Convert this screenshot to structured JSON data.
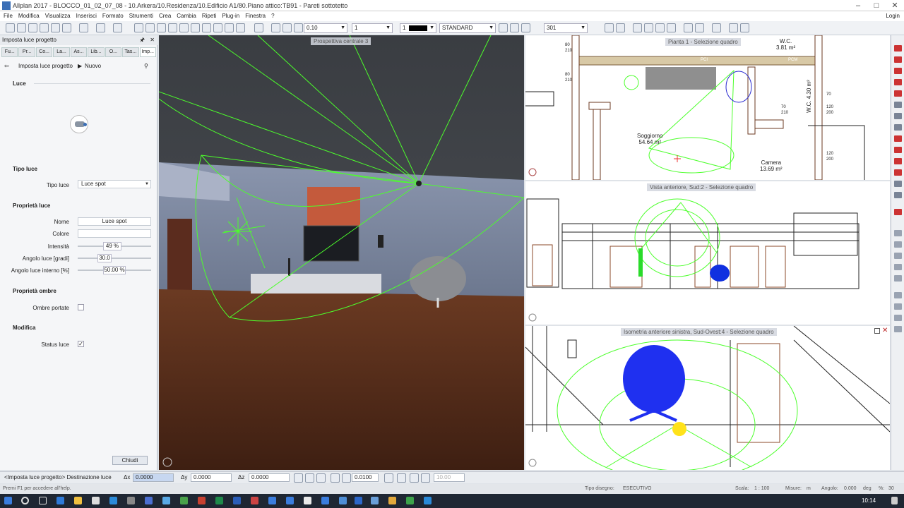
{
  "window": {
    "title": "Allplan 2017 - BLOCCO_01_02_07_08 - 10.Arkera/10.Residenza/10.Edificio A1/80.Piano attico:TB91 - Pareti sottotetto",
    "minimize": "–",
    "maximize": "□",
    "close": "✕"
  },
  "menu": {
    "items": [
      "File",
      "Modifica",
      "Visualizza",
      "Inserisci",
      "Formato",
      "Strumenti",
      "Crea",
      "Cambia",
      "Ripeti",
      "Plug-in",
      "Finestra",
      "?"
    ],
    "login": "Login"
  },
  "toolbar": {
    "pen": "0.10",
    "line": "1",
    "color": "1",
    "layer": "STANDARD",
    "scale": "301"
  },
  "panel": {
    "header": "Imposta luce progetto",
    "pin": "✕",
    "tabs": [
      "Fu...",
      "Pr...",
      "Co...",
      "La...",
      "As...",
      "Lib...",
      "O...",
      "Tas...",
      "Imp..."
    ],
    "back": "⇦",
    "breadcrumb": [
      "Imposta luce progetto",
      "Nuovo"
    ],
    "sections": {
      "luce": "Luce",
      "tipo": "Tipo luce",
      "proprieta": "Proprietà luce",
      "ombre": "Proprietà ombre",
      "modifica": "Modifica"
    },
    "fields": {
      "tipo_label": "Tipo luce",
      "tipo_value": "Luce spot",
      "nome_label": "Nome",
      "nome_value": "Luce spot",
      "colore_label": "Colore",
      "intensita_label": "Intensità",
      "intensita_value": "49 %",
      "angolo_label": "Angolo luce [gradi]",
      "angolo_value": "30.0",
      "interno_label": "Angolo luce interno [%]",
      "interno_value": "50.00 %",
      "ombre_label": "Ombre portate",
      "status_label": "Status luce",
      "status_check": "✓"
    },
    "close_button": "Chiudi"
  },
  "views": {
    "perspective": "Prospettiva centrale 3",
    "plan": "Pianta 1 - Selezione quadro",
    "front": "Vista anteriore, Sud:2 - Selezione quadro",
    "iso": "Isometria anteriore sinistra, Sud-Ovest:4 - Selezione quadro"
  },
  "plan_labels": {
    "wc1": "W.C.",
    "wc1_area": "3.81 m²",
    "wc2": "W.C.",
    "wc2_area": "4.30 m²",
    "soggiorno": "Soggiorno",
    "soggiorno_area": "54.64 m²",
    "camera": "Camera",
    "camera_area": "13.69 m²",
    "d1": "80",
    "d2": "210",
    "d3": "80",
    "d4": "210",
    "d5": "70",
    "d6": "210",
    "d7": "70",
    "d8": "120",
    "d9": "200",
    "d10": "120",
    "d11": "200",
    "tag1": "PCI",
    "tag2": "PCM"
  },
  "command": {
    "prompt": "<Imposta luce progetto> Destinazione luce",
    "dx_label": "Δx",
    "dx": "0.0000",
    "dy_label": "Δy",
    "dy": "0.0000",
    "dz_label": "Δz",
    "dz": "0.0000",
    "step": "0.0100",
    "angle": "10.00"
  },
  "status": {
    "hint": "Premi F1 per accedere all'help.",
    "tipo_disegno_label": "Tipo disegno:",
    "tipo_disegno": "ESECUTIVO",
    "scala_label": "Scala:",
    "scala": "1 : 100",
    "misure_label": "Misure:",
    "misure": "m",
    "angolo_label": "Angolo:",
    "angolo": "0.000",
    "unit": "deg",
    "pct_label": "%:",
    "pct": "30"
  },
  "taskbar": {
    "time": "10:14"
  }
}
